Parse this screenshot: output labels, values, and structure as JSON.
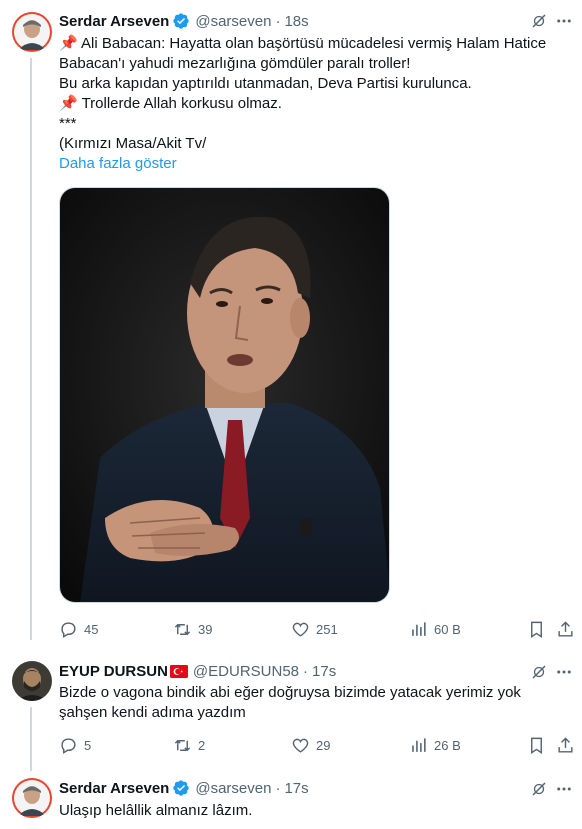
{
  "tweets": [
    {
      "author_name": "Serdar Arseven",
      "handle": "@sarseven",
      "separator": "·",
      "time": "18s",
      "text": "📌 Ali Babacan: Hayatta olan başörtüsü mücadelesi vermiş Halam Hatice Babacan'ı yahudi mezarlığına gömdüler paralı troller!\nBu arka kapıdan yaptırıldı utanmadan, Deva Partisi kurulunca.\n📌 Trollerde Allah korkusu olmaz.\n                         ***\n(Kırmızı Masa/Akit Tv/",
      "show_more": "Daha fazla göster",
      "replies": "45",
      "retweets": "39",
      "likes": "251",
      "views": "60 B"
    },
    {
      "author_name": "EYUP DURSUN",
      "flag": "🇹🇷",
      "handle": "@EDURSUN58",
      "separator": "·",
      "time": "17s",
      "text": "Bizde o vagona bindik abi eğer doğruysa bizimde yatacak yerimiz yok\nşahşen kendi adıma yazdım",
      "replies": "5",
      "retweets": "2",
      "likes": "29",
      "views": "26 B"
    },
    {
      "author_name": "Serdar Arseven",
      "handle": "@sarseven",
      "separator": "·",
      "time": "17s",
      "text": "Ulaşıp helâllik almanız lâzım."
    }
  ],
  "colors": {
    "text": "#0f1419",
    "secondary": "#536471",
    "link": "#1d9bf0",
    "verified": "#1d9bf0",
    "thread_line": "#cfd9de",
    "flag_red": "#e30a17"
  },
  "icons": [
    "verified-badge-icon",
    "grok-icon",
    "more-icon",
    "reply-icon",
    "retweet-icon",
    "like-icon",
    "views-icon",
    "bookmark-icon",
    "share-icon"
  ]
}
